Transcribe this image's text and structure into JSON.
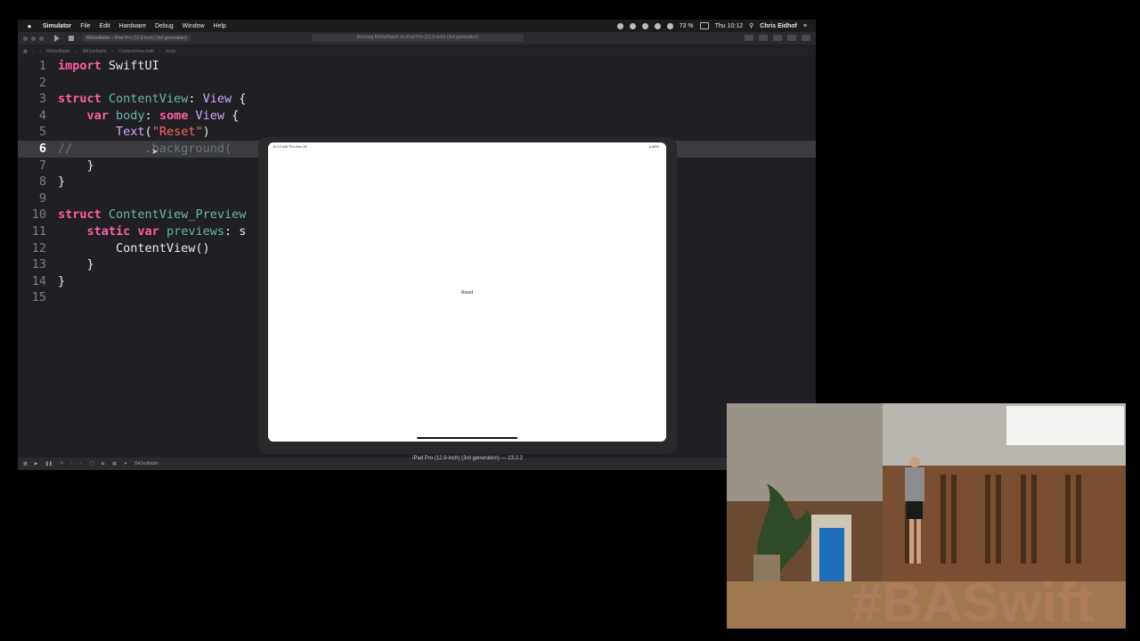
{
  "menubar": {
    "app": "Simulator",
    "items": [
      "File",
      "Edit",
      "Hardware",
      "Debug",
      "Window",
      "Help"
    ],
    "battery": "73 %",
    "clock": "Thu 10:12",
    "user": "Chris Eidhof"
  },
  "xcode": {
    "scheme": "BASwiftable",
    "device": "iPad Pro (12.9-inch) (3rd generation)",
    "status": "Running BASwiftable on iPad Pro (12.9-inch) (3rd generation)",
    "jumpbar": [
      "BASwiftable",
      "BASwiftable",
      "ContentView.swift",
      "body"
    ],
    "bottom_target": "BASwiftable"
  },
  "code_lines": [
    {
      "n": "1"
    },
    {
      "n": "2"
    },
    {
      "n": "3"
    },
    {
      "n": "4"
    },
    {
      "n": "5"
    },
    {
      "n": "6"
    },
    {
      "n": "7"
    },
    {
      "n": "8"
    },
    {
      "n": "9"
    },
    {
      "n": "10"
    },
    {
      "n": "11"
    },
    {
      "n": "12"
    },
    {
      "n": "13"
    },
    {
      "n": "14"
    },
    {
      "n": "15"
    }
  ],
  "code_tokens": {
    "l1_kw": "import",
    "l1_rest": " SwiftUI",
    "l3_kw": "struct",
    "l3_name": " ContentView",
    "l3_rest": ": ",
    "l3_ty": "View",
    "l3_end": " {",
    "l4_indent": "    ",
    "l4_kw": "var",
    "l4_id": " body",
    "l4_rest": ": ",
    "l4_kw2": "some",
    "l4_ty": " View",
    "l4_end": " {",
    "l5_indent": "        ",
    "l5_fn": "Text",
    "l5_p1": "(",
    "l5_str": "\"Reset\"",
    "l5_p2": ")",
    "l6_cm": "//",
    "l6_rest": "          .background(",
    "l7": "    }",
    "l8": "}",
    "l10_kw": "struct",
    "l10_name": " ContentView_Preview",
    "l11_indent": "    ",
    "l11_kw": "static",
    "l11_kw2": " var",
    "l11_id": " previews",
    "l11_rest": ": s",
    "l12": "        ContentView()",
    "l13": "    }",
    "l14": "}"
  },
  "simulator": {
    "time": "10:12 AM   Thu Nov 28",
    "status": "▴ 86%",
    "text": "Reset",
    "title": "iPad Pro (12.9-inch) (3rd generation) — 13.2.2"
  },
  "camera": {
    "banner": "#BASwift"
  }
}
